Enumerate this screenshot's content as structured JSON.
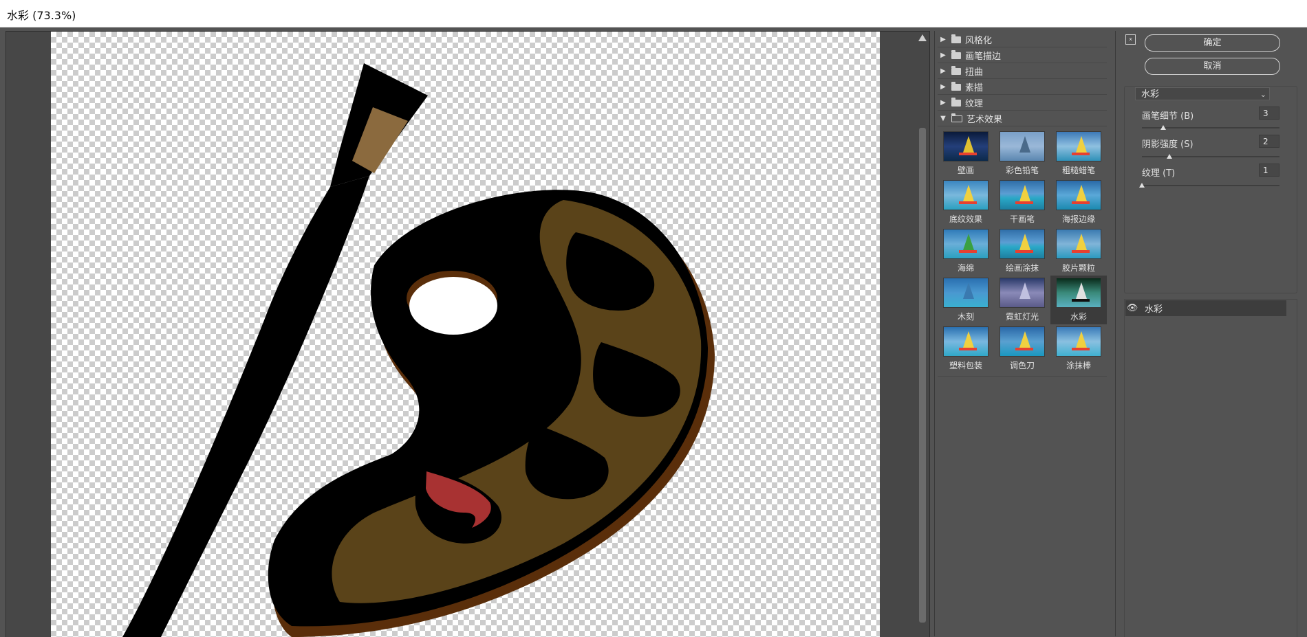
{
  "window": {
    "title": "水彩 (73.3%)"
  },
  "categories": [
    {
      "label": "风格化",
      "expanded": false
    },
    {
      "label": "画笔描边",
      "expanded": false
    },
    {
      "label": "扭曲",
      "expanded": false
    },
    {
      "label": "素描",
      "expanded": false
    },
    {
      "label": "纹理",
      "expanded": false
    },
    {
      "label": "艺术效果",
      "expanded": true
    }
  ],
  "filters": [
    {
      "label": "壁画"
    },
    {
      "label": "彩色铅笔"
    },
    {
      "label": "粗糙蜡笔"
    },
    {
      "label": "底纹效果"
    },
    {
      "label": "干画笔"
    },
    {
      "label": "海报边缘"
    },
    {
      "label": "海绵"
    },
    {
      "label": "绘画涂抹"
    },
    {
      "label": "胶片颗粒"
    },
    {
      "label": "木刻"
    },
    {
      "label": "霓虹灯光"
    },
    {
      "label": "水彩",
      "selected": true
    },
    {
      "label": "塑料包装"
    },
    {
      "label": "调色刀"
    },
    {
      "label": "涂抹棒"
    }
  ],
  "buttons": {
    "ok": "确定",
    "cancel": "取消"
  },
  "filter_select": {
    "value": "水彩"
  },
  "params": [
    {
      "label": "画笔细节 (B)",
      "value": "3",
      "min": 1,
      "max": 14
    },
    {
      "label": "阴影强度 (S)",
      "value": "2",
      "min": 0,
      "max": 10
    },
    {
      "label": "纹理 (T)",
      "value": "1",
      "min": 1,
      "max": 3
    }
  ],
  "layers": {
    "active": "水彩"
  },
  "colors": {
    "palette_black": "#000000",
    "palette_brown": "#5a4319",
    "palette_edge": "#5a2e0a",
    "paint_red": "#a83232",
    "ferrule": "#8b6a3e"
  }
}
